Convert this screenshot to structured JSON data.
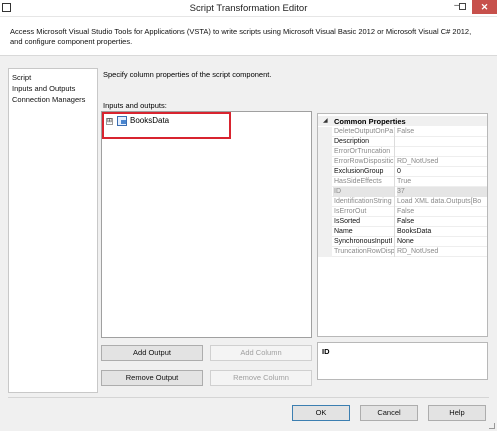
{
  "window": {
    "title": "Script Transformation Editor",
    "min_glyph": "–",
    "close_glyph": "✕"
  },
  "header": {
    "description": "Access Microsoft Visual Studio Tools for Applications (VSTA) to write scripts using Microsoft Visual Basic 2012 or Microsoft Visual C# 2012, and configure component properties."
  },
  "nav": {
    "items": [
      "Script",
      "Inputs and Outputs",
      "Connection Managers"
    ]
  },
  "main": {
    "instructions": "Specify column properties of the script component.",
    "io_label": "Inputs and outputs:",
    "tree": {
      "toggle": "⊞",
      "root_label": "BooksData"
    }
  },
  "properties": {
    "collapse_glyph": "◢",
    "category": "Common Properties",
    "rows": [
      {
        "name": "DeleteOutputOnPa",
        "value": "False",
        "disabled": true
      },
      {
        "name": "Description",
        "value": "",
        "disabled": false
      },
      {
        "name": "ErrorOrTruncation",
        "value": "",
        "disabled": true
      },
      {
        "name": "ErrorRowDispositic",
        "value": "RD_NotUsed",
        "disabled": true
      },
      {
        "name": "ExclusionGroup",
        "value": "0",
        "disabled": false
      },
      {
        "name": "HasSideEffects",
        "value": "True",
        "disabled": true
      },
      {
        "name": "ID",
        "value": "37",
        "disabled": true,
        "selected": true
      },
      {
        "name": "IdentificationString",
        "value": "Load XML data.Outputs[Bo",
        "disabled": true
      },
      {
        "name": "IsErrorOut",
        "value": "False",
        "disabled": true
      },
      {
        "name": "IsSorted",
        "value": "False",
        "disabled": false
      },
      {
        "name": "Name",
        "value": "BooksData",
        "disabled": false
      },
      {
        "name": "SynchronousInputI",
        "value": "None",
        "disabled": false
      },
      {
        "name": "TruncationRowDisp",
        "value": "RD_NotUsed",
        "disabled": true
      }
    ],
    "description_title": "ID"
  },
  "buttons": {
    "add_output": "Add Output",
    "add_column": "Add Column",
    "remove_output": "Remove Output",
    "remove_column": "Remove Column",
    "ok": "OK",
    "cancel": "Cancel",
    "help": "Help"
  }
}
